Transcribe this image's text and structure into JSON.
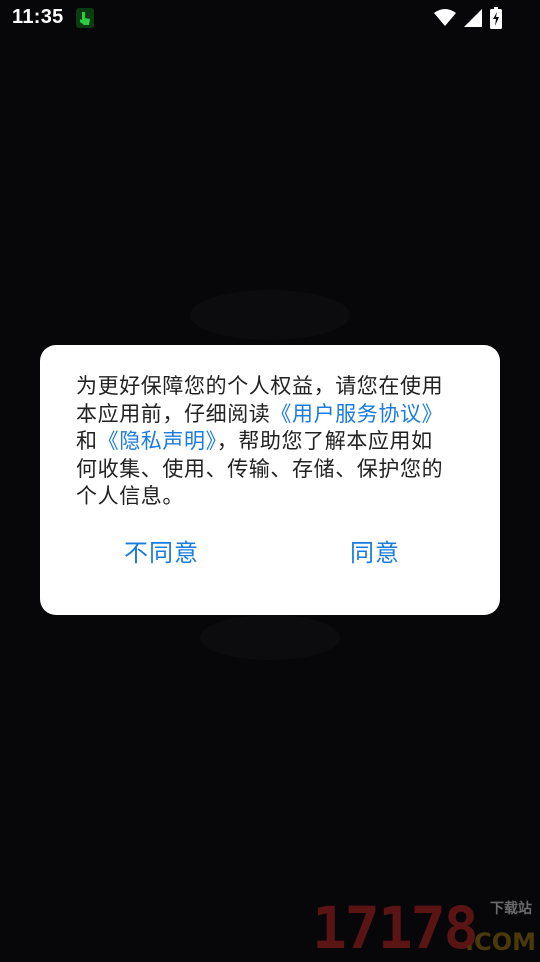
{
  "status_bar": {
    "time": "11:35",
    "icons": [
      "notification-app-icon",
      "wifi-icon",
      "cellular-signal-icon",
      "battery-charging-icon"
    ]
  },
  "dialog": {
    "message_parts": {
      "intro": "为更好保障您的个人权益，请您在使用本应用前，仔细阅读",
      "terms_link": "《用户服务协议》",
      "and_text": "和",
      "privacy_link": "《隐私声明》",
      "outro": "，帮助您了解本应用如何收集、使用、传输、存储、保护您的个人信息。"
    },
    "disagree_label": "不同意",
    "agree_label": "同意"
  },
  "watermark": {
    "digits": "17178",
    "domain": ".COM",
    "label": "下载站"
  },
  "colors": {
    "background": "#070709",
    "dialog_bg": "#ffffff",
    "text": "#222222",
    "accent": "#1a7ce0"
  }
}
